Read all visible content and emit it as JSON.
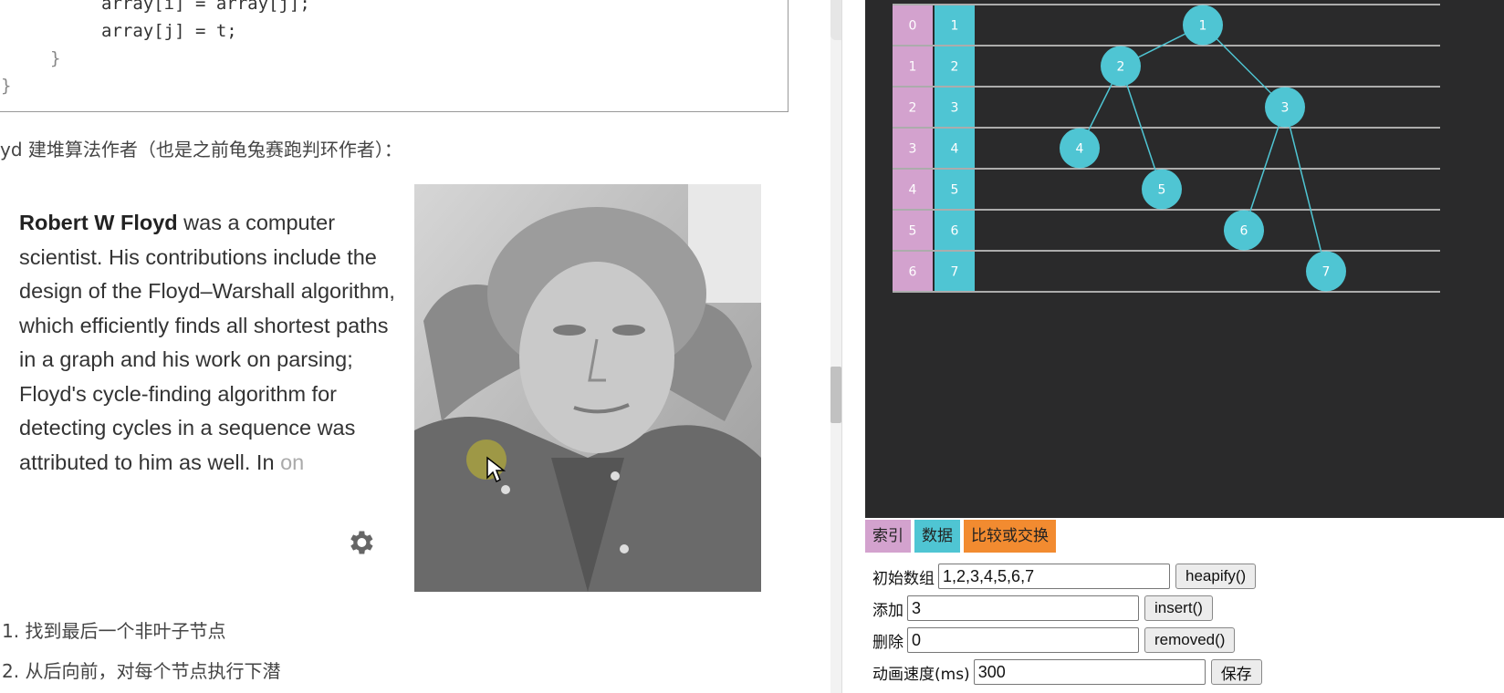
{
  "code": {
    "line1": "array[i] = array[j];",
    "line2": "array[j] = t;",
    "close_inner": "}",
    "close_outer": "}"
  },
  "doc": {
    "heading": "yd 建堆算法作者（也是之前龟兔赛跑判环作者）：",
    "bio_name": "Robert W Floyd",
    "bio_text": " was a computer scientist. His contributions include the design of the Floyd–Warshall algorithm, which efficiently finds all shortest paths in a graph and his work on parsing; Floyd's cycle-finding algorithm for detecting cycles in a sequence was attributed to him as well. In ",
    "bio_fade": "on",
    "step1": "1. 找到最后一个非叶子节点",
    "step2": "2. 从后向前，对每个节点执行下潜"
  },
  "heap": {
    "indices": [
      "0",
      "1",
      "2",
      "3",
      "4",
      "5",
      "6"
    ],
    "values": [
      "1",
      "2",
      "3",
      "4",
      "5",
      "6",
      "7"
    ],
    "colors": {
      "index": "#d3a2ce",
      "data": "#4fc5d3",
      "compare": "#f28b30",
      "background": "#2a2a2b"
    }
  },
  "legend": {
    "index": "索引",
    "data": "数据",
    "compare": "比较或交换"
  },
  "controls": {
    "init_label": "初始数组",
    "init_value": "1,2,3,4,5,6,7",
    "heapify_btn": "heapify()",
    "add_label": "添加",
    "add_value": "3",
    "insert_btn": "insert()",
    "del_label": "删除",
    "del_value": "0",
    "remove_btn": "removed()",
    "speed_label": "动画速度(ms)",
    "speed_value": "300",
    "save_btn": "保存"
  }
}
